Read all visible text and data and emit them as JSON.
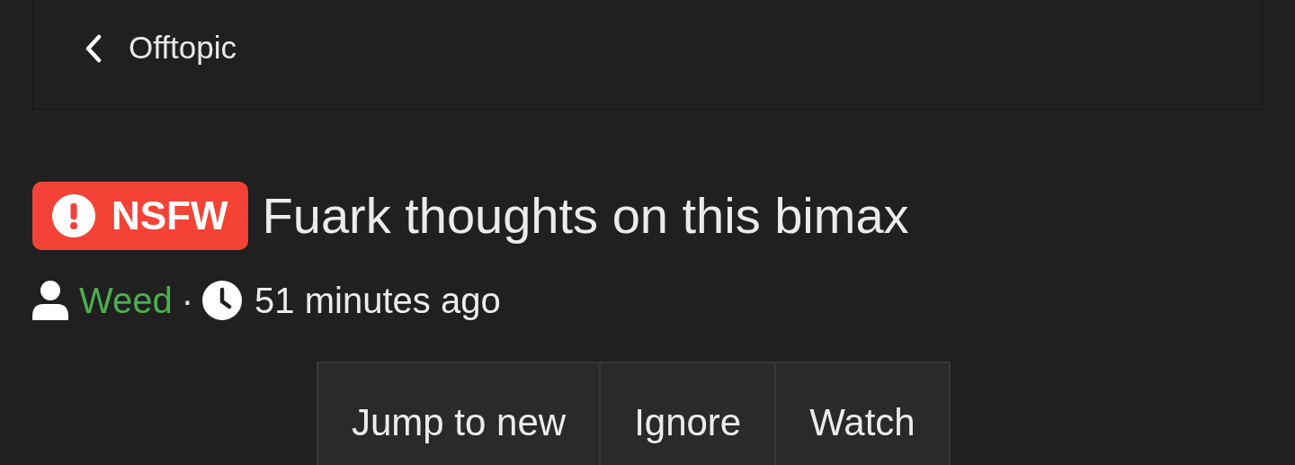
{
  "breadcrumb": {
    "label": "Offtopic"
  },
  "thread": {
    "prefix": "NSFW",
    "title": "Fuark thoughts on this bimax"
  },
  "meta": {
    "author": "Weed",
    "separator": "·",
    "time": "51 minutes ago"
  },
  "actions": [
    "Jump to new",
    "Ignore",
    "Watch"
  ]
}
